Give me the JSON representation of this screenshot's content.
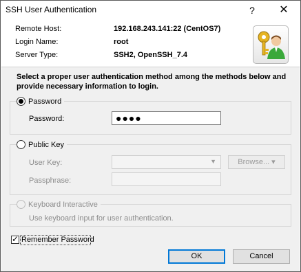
{
  "window": {
    "title": "SSH User Authentication",
    "help_label": "?",
    "close_label": "✕"
  },
  "header": {
    "remote_host_label": "Remote Host:",
    "remote_host_value": "192.168.243.141:22 (CentOS7)",
    "login_name_label": "Login Name:",
    "login_name_value": "root",
    "server_type_label": "Server Type:",
    "server_type_value": "SSH2, OpenSSH_7.4",
    "icon_name": "keys-user-icon"
  },
  "instructions": "Select a proper user authentication method among the methods below and provide necessary information to login.",
  "password_group": {
    "title": "Password",
    "selected": true,
    "field_label": "Password:",
    "field_value": "●●●●"
  },
  "public_key_group": {
    "title": "Public Key",
    "selected": false,
    "user_key_label": "User Key:",
    "user_key_value": "",
    "browse_label": "Browse... ▾",
    "passphrase_label": "Passphrase:",
    "passphrase_value": ""
  },
  "keyboard_group": {
    "title": "Keyboard Interactive",
    "selected": false,
    "enabled": false,
    "description": "Use keyboard input for user authentication."
  },
  "remember": {
    "label": "Remember Password",
    "checked": true
  },
  "buttons": {
    "ok": "OK",
    "cancel": "Cancel"
  },
  "colors": {
    "accent": "#0078d7",
    "panel": "#f0f0f0"
  }
}
